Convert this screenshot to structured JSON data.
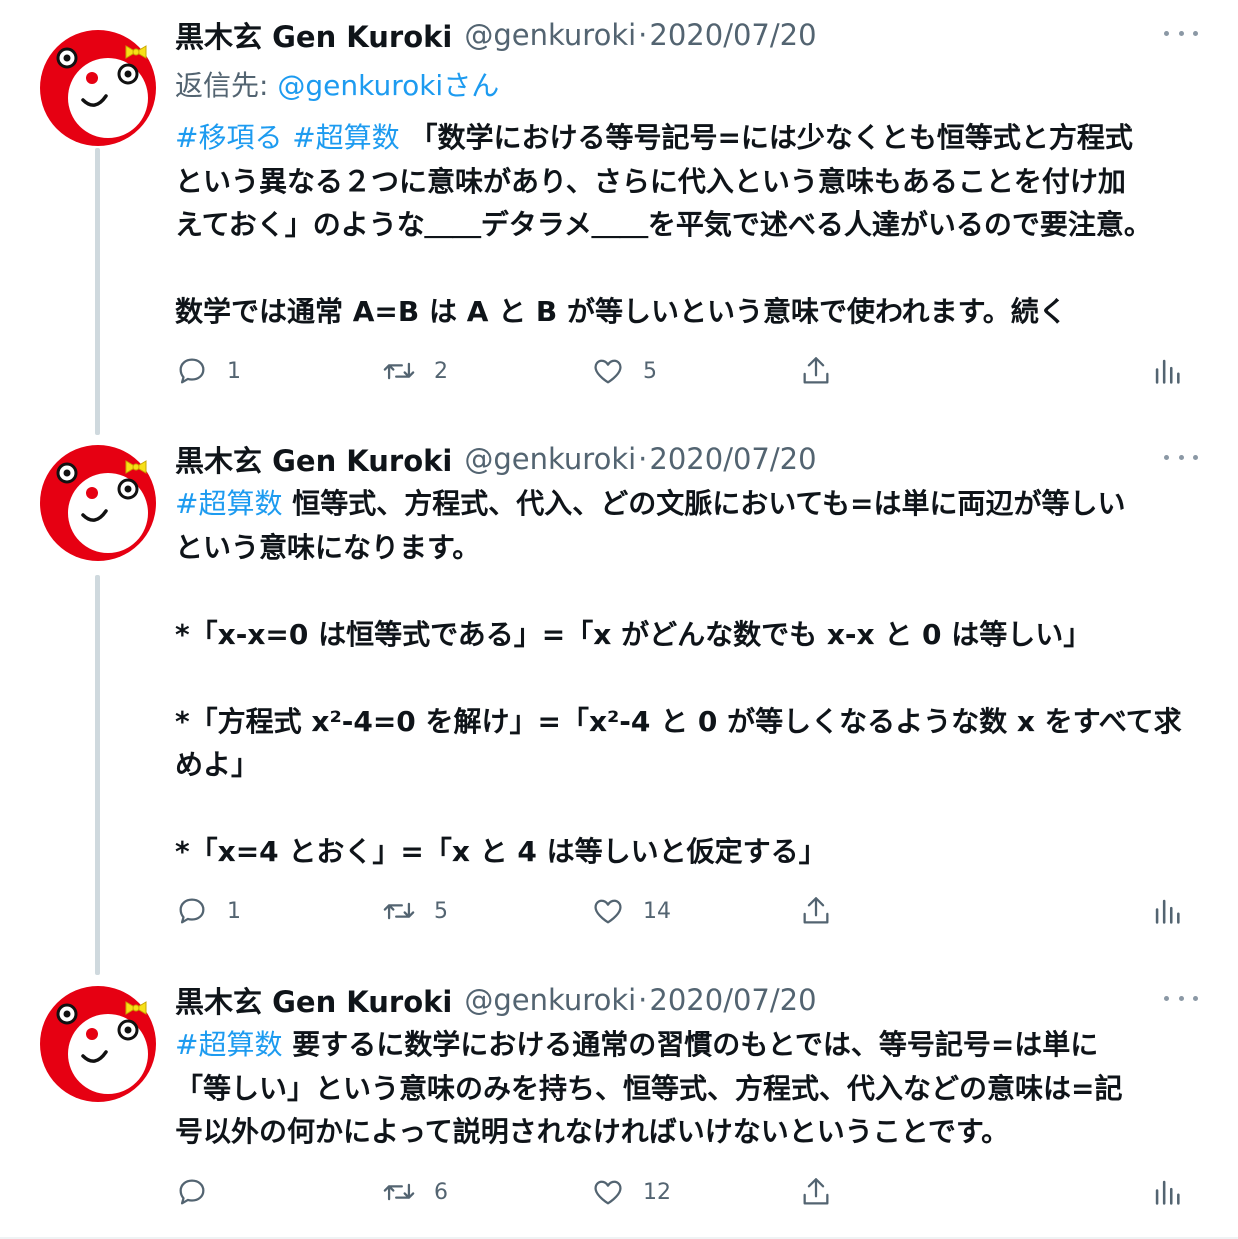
{
  "colors": {
    "accent": "#1d9bf0",
    "secondary_text": "#536471",
    "avatar_red": "#e60012",
    "thread_line": "#cfd9de"
  },
  "tweets": [
    {
      "display_name": "黒木玄 Gen Kuroki",
      "handle": "@genkuroki",
      "separator": "·",
      "date": "2020/07/20",
      "reply_to": {
        "label": "返信先: ",
        "mention": "@genkuroki",
        "suffix": "さん"
      },
      "hashtags": [
        "#移項る",
        "#超算数"
      ],
      "lines": [
        {
          "text": "「数学における等号記号=には少なくとも恒等式と方程式"
        },
        {
          "text": "という異なる２つに意味があり、さらに代入という意味もあることを付け加"
        },
        {
          "text": "えておく」のような＿＿デタラメ＿＿を平気で述べる人達がいるので要注意。"
        },
        {
          "text": ""
        },
        {
          "text": "数学では通常 A=B は A と B が等しいという意味で使われます。続く"
        }
      ],
      "stats": {
        "replies": "1",
        "retweets": "2",
        "likes": "5"
      }
    },
    {
      "display_name": "黒木玄 Gen Kuroki",
      "handle": "@genkuroki",
      "separator": "·",
      "date": "2020/07/20",
      "hashtags": [
        "#超算数"
      ],
      "lines": [
        {
          "text": "恒等式、方程式、代入、どの文脈においても=は単に両辺が等しい"
        },
        {
          "text": "という意味になります。"
        },
        {
          "text": ""
        },
        {
          "text": "*「x-x=0 は恒等式である」=「x がどんな数でも x-x と 0 は等しい」"
        },
        {
          "text": ""
        },
        {
          "text": "*「方程式 x²-4=0 を解け」=「x²-4 と 0 が等しくなるような数 x をすべて求"
        },
        {
          "text": "めよ」"
        },
        {
          "text": ""
        },
        {
          "text": "*「x=4 とおく」=「x と 4 は等しいと仮定する」"
        }
      ],
      "stats": {
        "replies": "1",
        "retweets": "5",
        "likes": "14"
      }
    },
    {
      "display_name": "黒木玄 Gen Kuroki",
      "handle": "@genkuroki",
      "separator": "·",
      "date": "2020/07/20",
      "hashtags": [
        "#超算数"
      ],
      "lines": [
        {
          "text": "要するに数学における通常の習慣のもとでは、等号記号=は単に"
        },
        {
          "text": "「等しい」という意味のみを持ち、恒等式、方程式、代入などの意味は=記"
        },
        {
          "text": "号以外の何かによって説明されなければいけないということです。"
        }
      ],
      "stats": {
        "replies": "",
        "retweets": "6",
        "likes": "12"
      }
    }
  ],
  "icons": {
    "reply": "speech-bubble-icon",
    "retweet": "retweet-arrows-icon",
    "like": "heart-icon",
    "share": "share-upload-icon",
    "stats": "bar-chart-icon",
    "more": "more-dots-icon"
  }
}
